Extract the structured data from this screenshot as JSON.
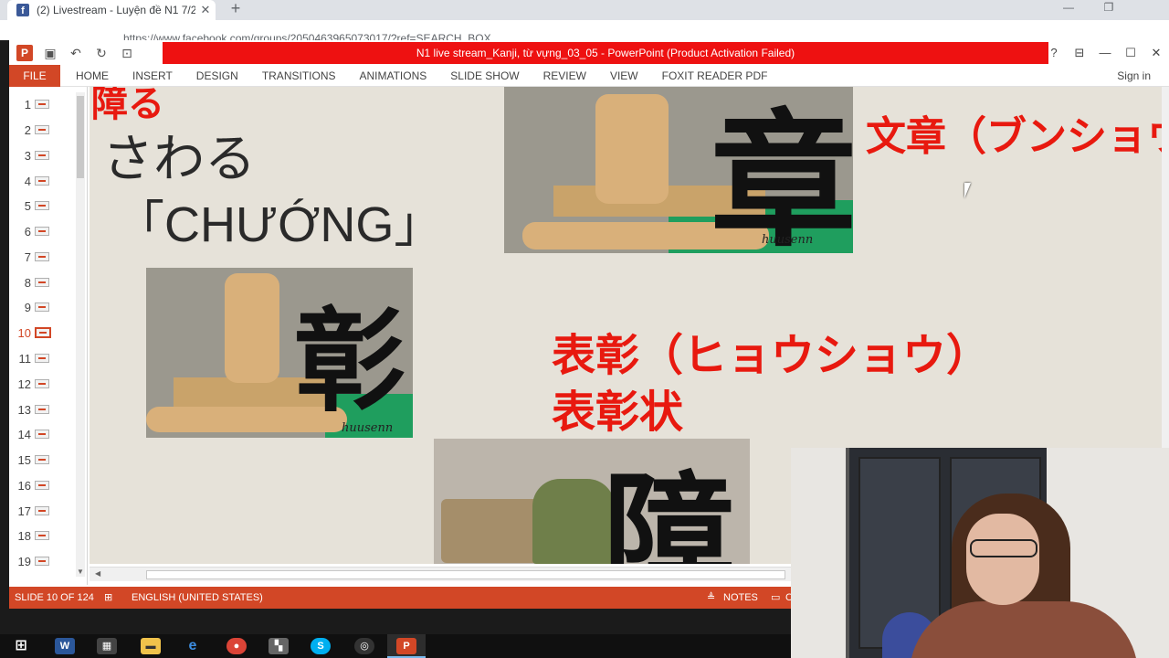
{
  "browser": {
    "tab_title": "(2) Livestream - Luyện đề N1 7/2",
    "tab_close": "✕",
    "new_tab": "+",
    "url": "https://www.facebook.com/groups/2050463965073017/?ref=SEARCH_BOX"
  },
  "ppt": {
    "window_title": "N1 live stream_Kanji, từ vựng_03_05 -  PowerPoint (Product Activation Failed)",
    "ribbon_file": "FILE",
    "ribbon_tabs": [
      "HOME",
      "INSERT",
      "DESIGN",
      "TRANSITIONS",
      "ANIMATIONS",
      "SLIDE SHOW",
      "REVIEW",
      "VIEW",
      "FOXIT READER PDF"
    ],
    "sign_in": "Sign in",
    "thumbnails": [
      "1",
      "2",
      "3",
      "4",
      "5",
      "6",
      "7",
      "8",
      "9",
      "10",
      "11",
      "12",
      "13",
      "14",
      "15",
      "16",
      "17",
      "18",
      "19"
    ],
    "active_slide": 10
  },
  "slide": {
    "kanji_fragment_top": "障る",
    "hiragana": "さわる",
    "reading": "「CHƯỚNG」",
    "word1": "文章（ブンショウ）",
    "word2": "表彰（ヒョウショウ）",
    "word3": "表彰状",
    "img1_kanji": "章",
    "img1_stamp": "huusenn",
    "img2_kanji": "彰",
    "img2_stamp": "huusenn",
    "img3_kanji": "障"
  },
  "status": {
    "slide_count": "SLIDE 10 OF 124",
    "language": "ENGLISH (UNITED STATES)",
    "notes": "NOTES",
    "comments": "C"
  },
  "taskbar": {
    "icons": [
      "windows-start",
      "word",
      "store",
      "file-explorer",
      "edge",
      "chrome",
      "app-grid",
      "skype",
      "obs",
      "powerpoint"
    ]
  },
  "colors": {
    "ppt_accent": "#d24726",
    "title_bar_red": "#ee1111",
    "slide_red_text": "#e8190f",
    "slide_bg": "#e6e2d9"
  }
}
